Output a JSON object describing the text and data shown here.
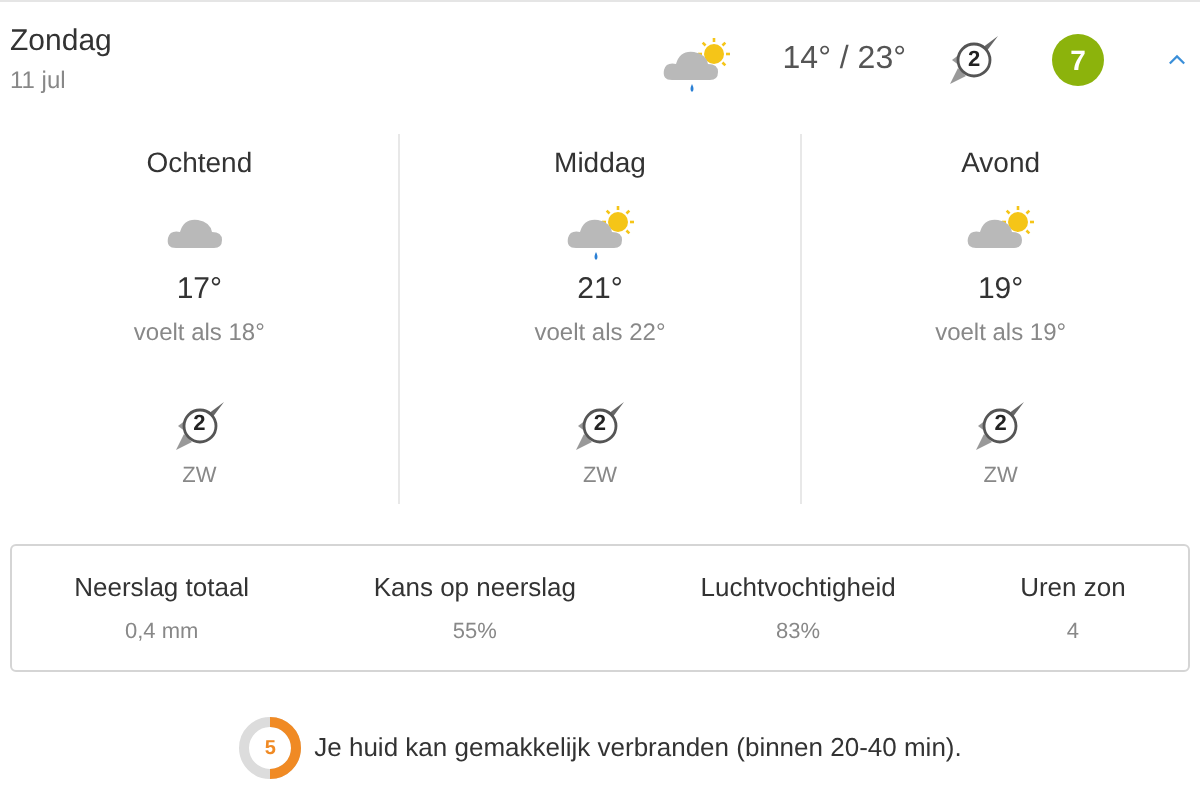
{
  "day": {
    "name": "Zondag",
    "date": "11 jul",
    "icon": {
      "kind": "partly-rain"
    },
    "temps": "14° / 23°",
    "wind_force": "2",
    "score": "7",
    "color": "#8cb30c",
    "expanded": true
  },
  "periods": [
    {
      "name": "Ochtend",
      "icon": {
        "kind": "cloudy"
      },
      "temp": "17°",
      "feels": "voelt als 18°",
      "wind_force": "2",
      "wind_dir": "ZW"
    },
    {
      "name": "Middag",
      "icon": {
        "kind": "partly-rain"
      },
      "temp": "21°",
      "feels": "voelt als 22°",
      "wind_force": "2",
      "wind_dir": "ZW"
    },
    {
      "name": "Avond",
      "icon": {
        "kind": "partly-cloudy"
      },
      "temp": "19°",
      "feels": "voelt als 19°",
      "wind_force": "2",
      "wind_dir": "ZW"
    }
  ],
  "stats": [
    {
      "label": "Neerslag totaal",
      "value": "0,4 mm"
    },
    {
      "label": "Kans op neerslag",
      "value": "55%"
    },
    {
      "label": "Luchtvochtigheid",
      "value": "83%"
    },
    {
      "label": "Uren zon",
      "value": "4"
    }
  ],
  "uv": {
    "index": "5",
    "text": "Je huid kan gemakkelijk verbranden (binnen 20-40 min)."
  }
}
